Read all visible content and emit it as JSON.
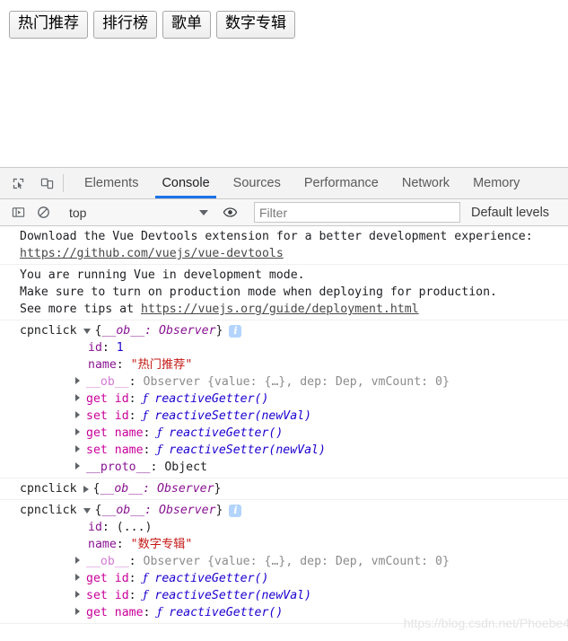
{
  "page": {
    "buttons": [
      {
        "label": "热门推荐"
      },
      {
        "label": "排行榜"
      },
      {
        "label": "歌单"
      },
      {
        "label": "数字专辑"
      }
    ]
  },
  "devtools": {
    "icons": {
      "inspect": "inspect-element-icon",
      "device": "device-toolbar-icon",
      "sidebar": "console-sidebar-icon",
      "clear": "clear-console-icon",
      "eye": "live-expression-eye-icon"
    },
    "tabs": [
      {
        "label": "Elements",
        "active": false
      },
      {
        "label": "Console",
        "active": true
      },
      {
        "label": "Sources",
        "active": false
      },
      {
        "label": "Performance",
        "active": false
      },
      {
        "label": "Network",
        "active": false
      },
      {
        "label": "Memory",
        "active": false
      }
    ],
    "accent_color": "#1a73e8",
    "filterbar": {
      "context": "top",
      "filter_value": "",
      "filter_placeholder": "Filter",
      "levels": "Default levels"
    }
  },
  "console": {
    "messages": {
      "vue_devtools_line1": "Download the Vue Devtools extension for a better development experience:",
      "vue_devtools_url": "https://github.com/vuejs/vue-devtools",
      "dev_mode_line1": "You are running Vue in development mode.",
      "dev_mode_line2": "Make sure to turn on production mode when deploying for production.",
      "dev_mode_line3_prefix": "See more tips at ",
      "dev_mode_url": "https://vuejs.org/guide/deployment.html"
    },
    "log_label": "cpnclick",
    "object_preview": "{__ob__: Observer}",
    "preview_brace_open": "{",
    "preview_body": "__ob__: Observer",
    "preview_brace_close": "}",
    "info_badge": "i",
    "groups": [
      {
        "expanded": true,
        "has_badge": true,
        "props": [
          {
            "kind": "value",
            "key": "id",
            "sep": ": ",
            "value": "1",
            "value_type": "num"
          },
          {
            "kind": "value",
            "key": "name",
            "sep": ": ",
            "value": "\"热门推荐\"",
            "value_type": "str"
          },
          {
            "kind": "expandable",
            "key": "__ob__",
            "key_type": "dim",
            "sep": ": ",
            "value": "Observer {value: {…}, dep: Dep, vmCount: 0}",
            "value_type": "observer"
          },
          {
            "kind": "expandable",
            "key": "get id",
            "key_type": "acc",
            "sep": ": ",
            "value": "reactiveGetter()",
            "value_type": "fn"
          },
          {
            "kind": "expandable",
            "key": "set id",
            "key_type": "acc",
            "sep": ": ",
            "value": "reactiveSetter(newVal)",
            "value_type": "fn"
          },
          {
            "kind": "expandable",
            "key": "get name",
            "key_type": "acc",
            "sep": ": ",
            "value": "reactiveGetter()",
            "value_type": "fn"
          },
          {
            "kind": "expandable",
            "key": "set name",
            "key_type": "acc",
            "sep": ": ",
            "value": "reactiveSetter(newVal)",
            "value_type": "fn"
          },
          {
            "kind": "expandable",
            "key": "__proto__",
            "key_type": "proto",
            "sep": ": ",
            "value": "Object",
            "value_type": "plain"
          }
        ]
      },
      {
        "expanded": false,
        "has_badge": false,
        "props": []
      },
      {
        "expanded": true,
        "has_badge": true,
        "props": [
          {
            "kind": "value",
            "key": "id",
            "sep": ": ",
            "value": "(...)",
            "value_type": "plain"
          },
          {
            "kind": "value",
            "key": "name",
            "sep": ": ",
            "value": "\"数字专辑\"",
            "value_type": "str"
          },
          {
            "kind": "expandable",
            "key": "__ob__",
            "key_type": "dim",
            "sep": ": ",
            "value": "Observer {value: {…}, dep: Dep, vmCount: 0}",
            "value_type": "observer"
          },
          {
            "kind": "expandable",
            "key": "get id",
            "key_type": "acc",
            "sep": ": ",
            "value": "reactiveGetter()",
            "value_type": "fn"
          },
          {
            "kind": "expandable",
            "key": "set id",
            "key_type": "acc",
            "sep": ": ",
            "value": "reactiveSetter(newVal)",
            "value_type": "fn"
          },
          {
            "kind": "expandable",
            "key": "get name",
            "key_type": "acc",
            "sep": ": ",
            "value": "reactiveGetter()",
            "value_type": "fn"
          }
        ]
      }
    ],
    "fn_symbol": "ƒ",
    "observer_parts": {
      "class_name": "Observer ",
      "open": "{",
      "k_value": "value",
      "v_value": "{…}",
      "k_dep": "dep",
      "v_dep": "Dep",
      "k_vmcount": "vmCount",
      "v_vmcount": "0",
      "close": "}"
    }
  },
  "watermark": "https://blog.csdn.net/Phoebe4"
}
